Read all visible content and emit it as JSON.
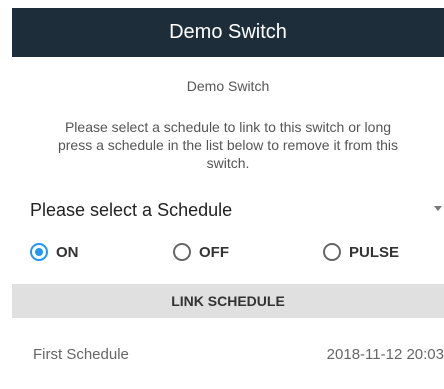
{
  "header": {
    "title": "Demo Switch"
  },
  "switch": {
    "name": "Demo Switch",
    "instructions": "Please select a schedule to link to this switch or long press a schedule in the list below to remove it from this switch."
  },
  "schedule_select": {
    "label": "Please select a Schedule"
  },
  "radio_options": [
    {
      "label": "ON",
      "checked": true
    },
    {
      "label": "OFF",
      "checked": false
    },
    {
      "label": "PULSE",
      "checked": false
    }
  ],
  "link_button": {
    "label": "LINK SCHEDULE"
  },
  "schedules": [
    {
      "name": "First Schedule",
      "date": "2018-11-12 20:03"
    }
  ],
  "colors": {
    "header_bg": "#1d2e3a",
    "accent": "#2196f3",
    "button_bg": "#e0e0e0"
  }
}
